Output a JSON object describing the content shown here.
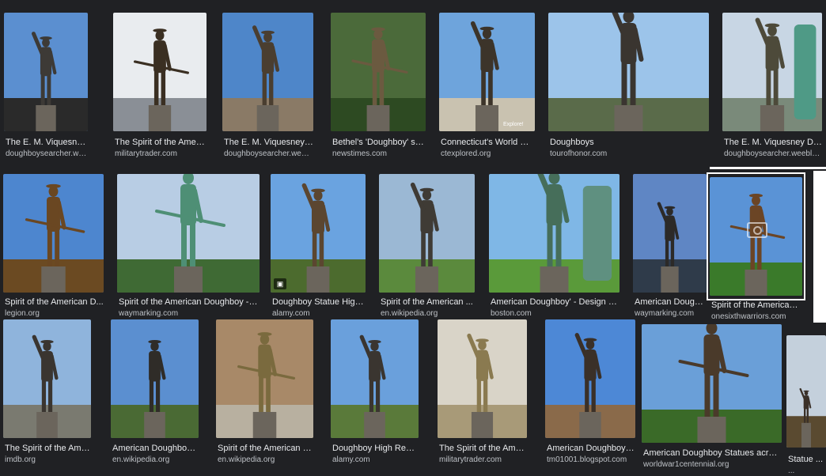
{
  "results": [
    {
      "title": "The E. M. Viquesney D...",
      "source": "doughboysearcher.weebl..."
    },
    {
      "title": "The Spirit of the Ameri...",
      "source": "militarytrader.com"
    },
    {
      "title": "The E. M. Viquesney D...",
      "source": "doughboysearcher.weebl..."
    },
    {
      "title": "Bethel's 'Doughboy' sta...",
      "source": "newstimes.com"
    },
    {
      "title": "Connecticut's World Wa...",
      "source": "ctexplored.org"
    },
    {
      "title": "Doughboys",
      "source": "tourofhonor.com"
    },
    {
      "title": "The E. M. Viquesney Dou...",
      "source": "doughboysearcher.weebly...."
    },
    {
      "title": "Spirit of the American D...",
      "source": "legion.org"
    },
    {
      "title": "Spirit of the American Doughboy - N...",
      "source": "waymarking.com"
    },
    {
      "title": "Doughboy Statue High ...",
      "source": "alamy.com"
    },
    {
      "title": "Spirit of the American ...",
      "source": "en.wikipedia.org"
    },
    {
      "title": "American Doughboy' - Design Ne...",
      "source": "boston.com"
    },
    {
      "title": "American Doughboy ...",
      "source": "waymarking.com"
    },
    {
      "title": "Spirit of the American ...",
      "source": "onesixthwarriors.com"
    },
    {
      "title": "The Spirit of the Ameri...",
      "source": "imdb.org"
    },
    {
      "title": "American Doughboy Br...",
      "source": "en.wikipedia.org"
    },
    {
      "title": "Spirit of the American D...",
      "source": "en.wikipedia.org"
    },
    {
      "title": "Doughboy High Resolu...",
      "source": "alamy.com"
    },
    {
      "title": "The Spirit of the Ameri...",
      "source": "militarytrader.com"
    },
    {
      "title": "American Doughboy - B...",
      "source": "tm01001.blogspot.com"
    },
    {
      "title": "American Doughboy Statues across...",
      "source": "worldwar1centennial.org"
    },
    {
      "title": "Statue ...",
      "source": "..."
    }
  ],
  "overlay_text": {
    "explore": "Explore!"
  },
  "colors": {
    "background": "#202124",
    "title": "#e8eaed",
    "source": "#bdc1c6",
    "sky": "#5b8fd0",
    "bronze": "#4a3a28",
    "green": "#3f7a3a"
  }
}
